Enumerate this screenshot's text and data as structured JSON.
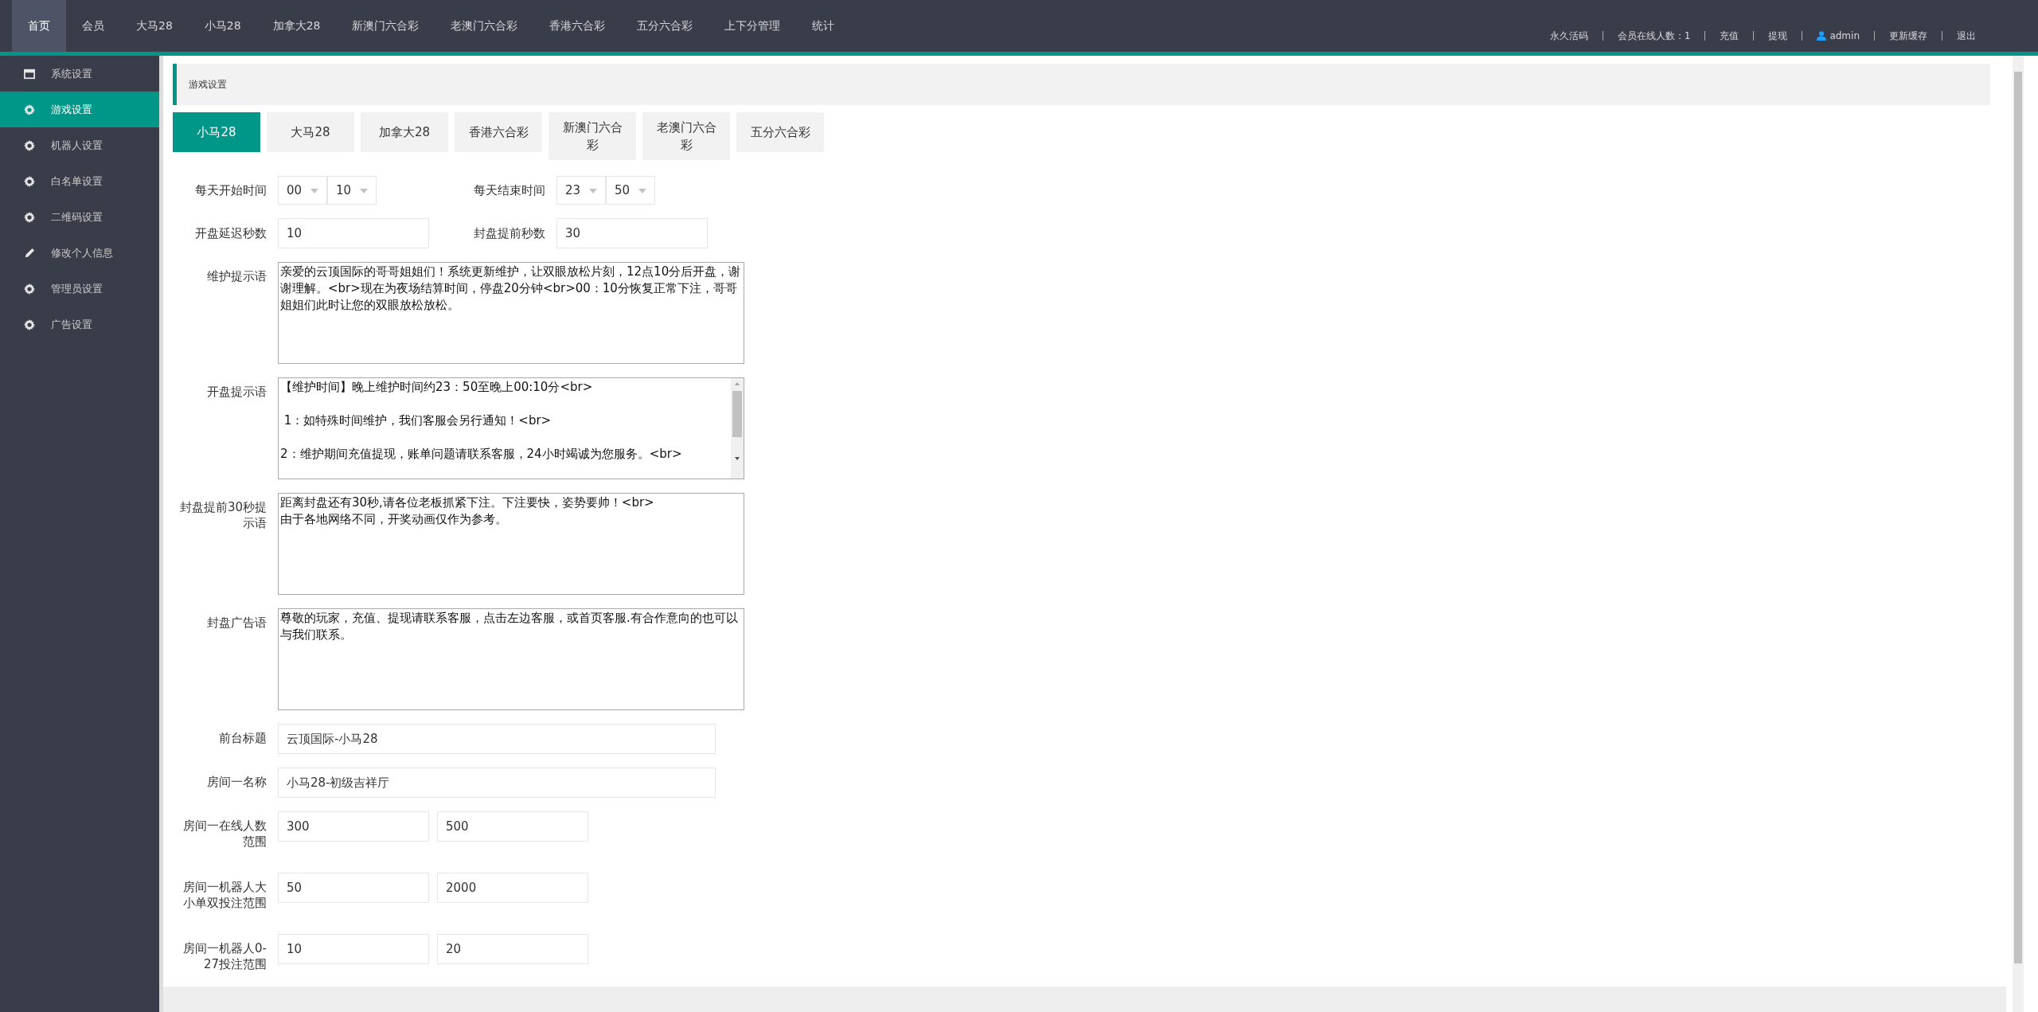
{
  "top_nav": {
    "items": [
      {
        "label": "首页",
        "selected": true
      },
      {
        "label": "会员",
        "selected": false
      },
      {
        "label": "大马28",
        "selected": false
      },
      {
        "label": "小马28",
        "selected": false
      },
      {
        "label": "加拿大28",
        "selected": false
      },
      {
        "label": "新澳门六合彩",
        "selected": false
      },
      {
        "label": "老澳门六合彩",
        "selected": false
      },
      {
        "label": "香港六合彩",
        "selected": false
      },
      {
        "label": "五分六合彩",
        "selected": false
      },
      {
        "label": "上下分管理",
        "selected": false
      },
      {
        "label": "统计",
        "selected": false
      }
    ],
    "right_links": [
      {
        "label": "永久活码",
        "kind": "link"
      },
      {
        "label": "会员在线人数：1",
        "kind": "text"
      },
      {
        "label": "充值",
        "kind": "link"
      },
      {
        "label": "提现",
        "kind": "link"
      },
      {
        "label": "admin",
        "kind": "user"
      },
      {
        "label": "更新缓存",
        "kind": "link"
      },
      {
        "label": "退出",
        "kind": "link"
      }
    ]
  },
  "sidebar": {
    "items": [
      {
        "label": "系统设置",
        "kind": "window",
        "selected": false
      },
      {
        "label": "游戏设置",
        "kind": "gear",
        "selected": true
      },
      {
        "label": "机器人设置",
        "kind": "gear",
        "selected": false
      },
      {
        "label": "白名单设置",
        "kind": "gear",
        "selected": false
      },
      {
        "label": "二维码设置",
        "kind": "gear",
        "selected": false
      },
      {
        "label": "修改个人信息",
        "kind": "pencil",
        "selected": false
      },
      {
        "label": "管理员设置",
        "kind": "gear",
        "selected": false
      },
      {
        "label": "广告设置",
        "kind": "gear",
        "selected": false
      }
    ]
  },
  "breadcrumb": "游戏设置",
  "game_tabs": [
    {
      "label": "小马28",
      "selected": true
    },
    {
      "label": "大马28",
      "selected": false
    },
    {
      "label": "加拿大28",
      "selected": false
    },
    {
      "label": "香港六合彩",
      "selected": false
    },
    {
      "label": "新澳门六合彩",
      "selected": false
    },
    {
      "label": "老澳门六合彩",
      "selected": false
    },
    {
      "label": "五分六合彩",
      "selected": false
    }
  ],
  "form": {
    "rows": [
      {
        "kind": "split",
        "groups": [
          {
            "label": "每天开始时间",
            "kind": "selects",
            "values": [
              "00",
              "10"
            ]
          },
          {
            "label": "每天结束时间",
            "kind": "selects",
            "values": [
              "23",
              "50"
            ]
          }
        ]
      },
      {
        "kind": "split",
        "groups": [
          {
            "label": "开盘延迟秒数",
            "kind": "input",
            "values": [
              "10"
            ]
          },
          {
            "label": "封盘提前秒数",
            "kind": "input",
            "values": [
              "30"
            ]
          }
        ]
      },
      {
        "kind": "textarea",
        "label": "维护提示语",
        "value": "亲爱的云顶国际的哥哥姐姐们！系统更新维护，让双眼放松片刻，12点10分后开盘，谢谢理解。<br>现在为夜场结算时间，停盘20分钟<br>00：10分恢复正常下注，哥哥姐姐们此时让您的双眼放松放松。"
      },
      {
        "kind": "scroll_textarea",
        "label": "开盘提示语",
        "value": "【维护时间】晚上维护时间约23：50至晚上00:10分<br>\n\n 1：如特殊时间维护，我们客服会另行通知！<br>\n\n2：维护期间充值提现，账单问题请联系客服，24小时竭诚为您服务。<br>"
      },
      {
        "kind": "textarea",
        "label": "封盘提前30秒提示语",
        "value": "距离封盘还有30秒,请各位老板抓紧下注。下注要快，姿势要帅！<br>\n由于各地网络不同，开奖动画仅作为参考。"
      },
      {
        "kind": "textarea",
        "label": "封盘广告语",
        "value": "尊敬的玩家，充值、提现请联系客服，点击左边客服，或首页客服.有合作意向的也可以与我们联系。"
      },
      {
        "kind": "wide",
        "label": "前台标题",
        "values": [
          "云顶国际-小马28"
        ]
      },
      {
        "kind": "wide",
        "label": "房间一名称",
        "values": [
          "小马28-初级吉祥厅"
        ]
      },
      {
        "kind": "pair",
        "label": "房间一在线人数范围",
        "values": [
          "300",
          "500"
        ]
      },
      {
        "kind": "pair",
        "label": "房间一机器人大小单双投注范围",
        "values": [
          "50",
          "2000"
        ]
      },
      {
        "kind": "pair",
        "label": "房间一机器人0-27投注范围",
        "values": [
          "10",
          "20"
        ]
      }
    ]
  }
}
